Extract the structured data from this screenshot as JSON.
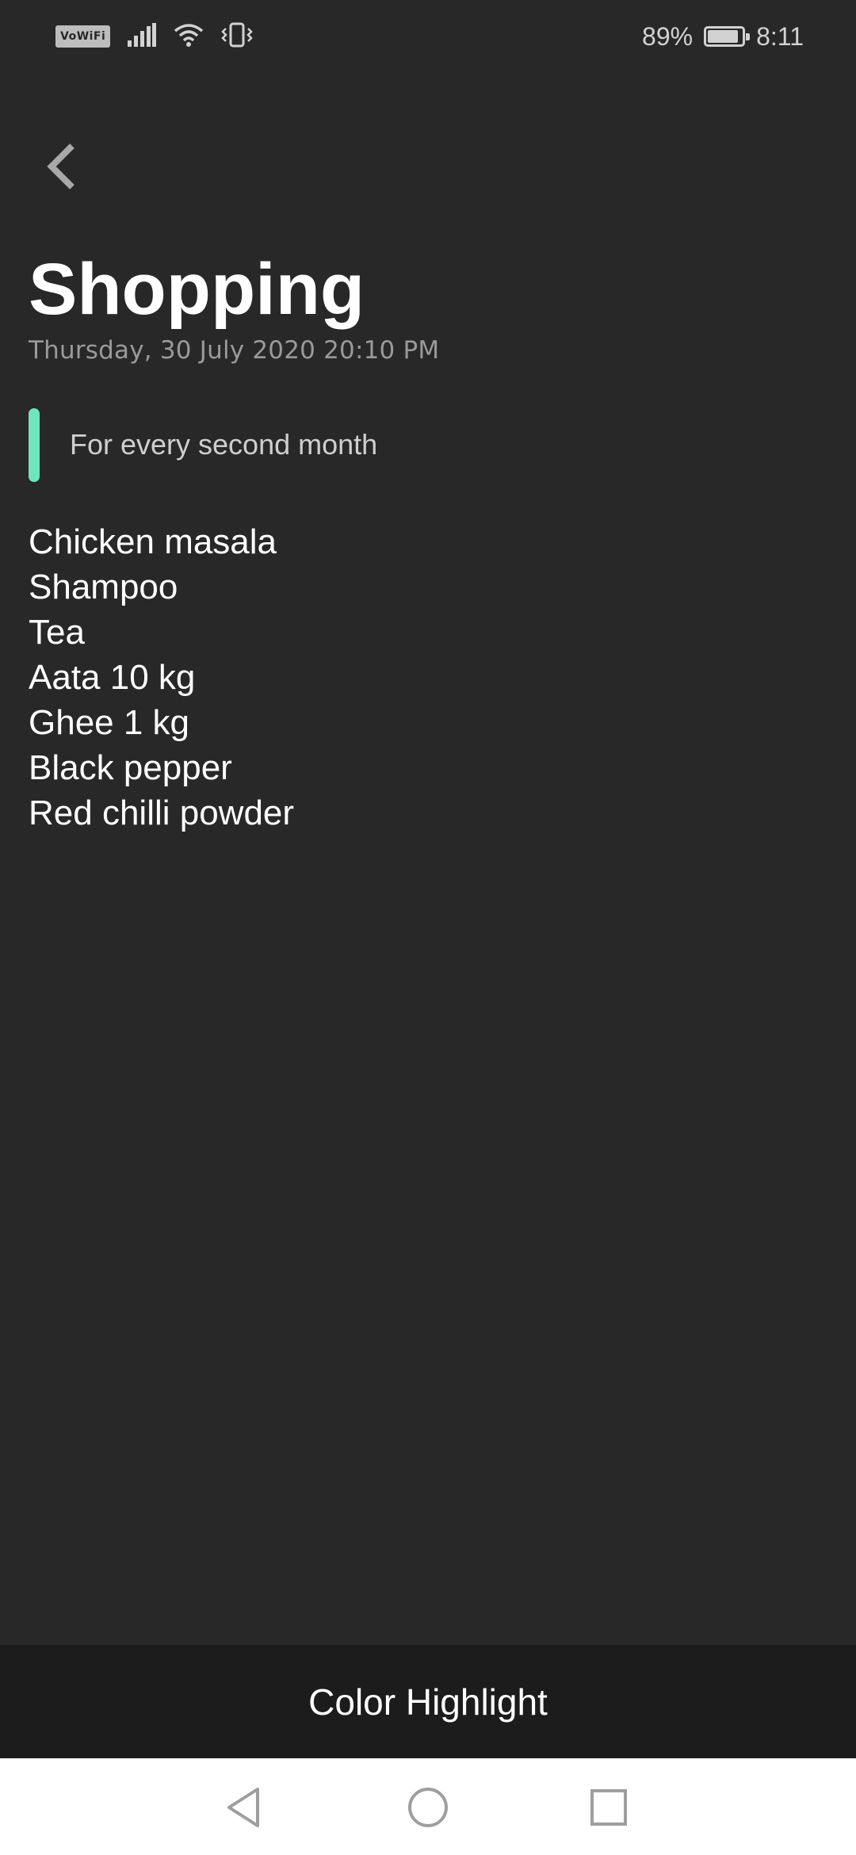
{
  "status_bar": {
    "vowifi_label": "VoWiFi",
    "battery_percent": "89%",
    "battery_level": 0.89,
    "time": "8:11",
    "icons": [
      "signal-icon",
      "wifi-icon",
      "vibrate-icon",
      "battery-icon"
    ]
  },
  "header": {
    "back_icon": "chevron-left-icon",
    "title": "Shopping",
    "date": "Thursday, 30 July 2020 20:10 PM"
  },
  "note": {
    "description": "For every second month",
    "accent_color": "#6ee5bc",
    "items": [
      "Chicken masala",
      "Shampoo",
      "Tea",
      "Aata 10 kg",
      "Ghee 1 kg",
      "Black pepper",
      "Red chilli powder"
    ]
  },
  "action_bar": {
    "label": "Color Highlight"
  },
  "nav_bar": {
    "icons": [
      "nav-back-icon",
      "nav-home-icon",
      "nav-recents-icon"
    ]
  },
  "colors": {
    "background": "#282828",
    "action_bar": "#1c1c1c",
    "nav_bar": "#ffffff"
  }
}
